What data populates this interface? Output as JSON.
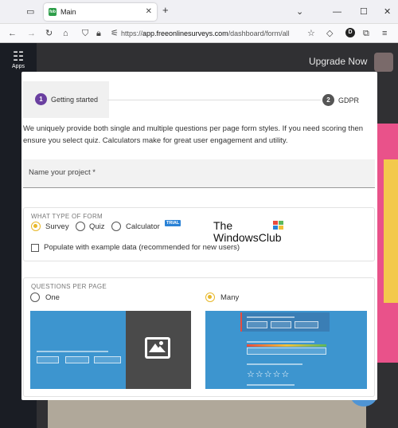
{
  "browser": {
    "tab_title": "Main",
    "favicon_text": "fob",
    "url_host": "app.freeonlinesurveys.com",
    "url_prefix": "https://",
    "url_path": "/dashboard/form/all"
  },
  "app": {
    "sidebar_apps_label": "Apps",
    "upgrade_label": "Upgrade Now"
  },
  "stepper": {
    "step1_num": "1",
    "step1_label": "Getting started",
    "step2_num": "2",
    "step2_label": "GDPR",
    "active_color": "#6a3fa0",
    "inactive_color": "#555555"
  },
  "intro_text": "We uniquely provide both single and multiple questions per page form styles. If you need scoring then ensure you select quiz. Calculators make for great user engagement and utility.",
  "project_name_placeholder": "Name your project *",
  "form_type": {
    "title": "WHAT TYPE OF FORM",
    "options": [
      "Survey",
      "Quiz",
      "Calculator"
    ],
    "selected": "Survey",
    "trial_badge": "TRIAL",
    "example_data_label": "Populate with example data (recommended for new users)",
    "example_data_checked": false
  },
  "questions_per_page": {
    "title": "QUESTIONS PER PAGE",
    "options": [
      "One",
      "Many"
    ],
    "selected": "Many"
  },
  "watermark": {
    "line1": "The",
    "line2": "WindowsClub"
  },
  "colors": {
    "accent": "#e8b82a",
    "preview_blue": "#3d95cf",
    "trial_blue": "#2a82d6"
  }
}
